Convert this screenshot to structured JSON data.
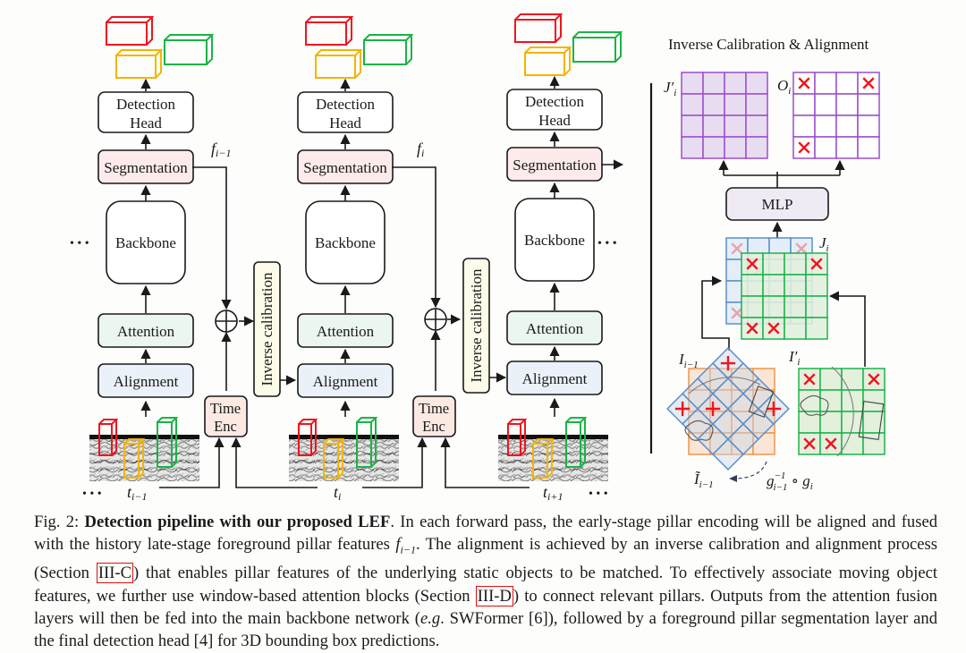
{
  "figure": {
    "pipeline": {
      "stages": [
        {
          "id": "prev",
          "detection_head": [
            "Detection",
            "Head"
          ],
          "segmentation": "Segmentation",
          "backbone": "Backbone",
          "attention": "Attention",
          "alignment": "Alignment",
          "feature_label": "f",
          "feature_sub": "i−1",
          "time_label": "t",
          "time_sub": "i−1"
        },
        {
          "id": "curr",
          "detection_head": [
            "Detection",
            "Head"
          ],
          "segmentation": "Segmentation",
          "backbone": "Backbone",
          "attention": "Attention",
          "alignment": "Alignment",
          "feature_label": "f",
          "feature_sub": "i",
          "time_label": "t",
          "time_sub": "i"
        },
        {
          "id": "next",
          "detection_head": [
            "Detection",
            "Head"
          ],
          "segmentation": "Segmentation",
          "backbone": "Backbone",
          "attention": "Attention",
          "alignment": "Alignment",
          "time_label": "t",
          "time_sub": "i+1"
        }
      ],
      "inverse_calibration": "Inverse calibration",
      "time_enc": [
        "Time",
        "Enc"
      ],
      "ellipsis": "• • •",
      "fusion_symbol": "⊕"
    },
    "inset": {
      "title": "Inverse Calibration & Alignment",
      "mlp": "MLP",
      "labels": {
        "J_prime": "J′",
        "J_prime_sub": "i",
        "O": "O",
        "O_sub": "i",
        "J": "J",
        "J_sub": "i",
        "I_prev": "I",
        "I_prev_sub": "i−1",
        "I_prime": "I′",
        "I_prime_sub": "i",
        "I_tilde": "Ĩ",
        "I_tilde_sub": "i−1",
        "transform": "g",
        "transform_sup": "−1",
        "transform_sub1": "i−1",
        "transform_tail": " ∘ g",
        "transform_sub2": "i"
      }
    },
    "colors": {
      "red_box": "#f0141e",
      "yellow_box": "#f5b400",
      "green_box": "#19b446",
      "segmentation_fill": "#fcebea",
      "attention_fill": "#eaf6ee",
      "alignment_fill": "#eaf1f8",
      "inverse_fill": "#fdfbe9",
      "timeenc_fill": "#fbe9e2",
      "mlp_fill": "#f0eaf4",
      "purple_grid": "#9a4fcc",
      "purple_fill": "#e8dcf0",
      "blue_grid": "#5a8fca",
      "blue_fill": "#e5eef8",
      "green_grid": "#1cb44c",
      "green_fill": "#e2f0dc",
      "orange_grid": "#f0954a",
      "orange_fill": "#fbe6d6"
    }
  },
  "caption": {
    "fig_label": "Fig. 2: ",
    "bold_title": "Detection pipeline with our proposed LEF",
    "text1": ". In each forward pass, the early-stage pillar encoding will be aligned and fused with the history late-stage foreground pillar features ",
    "f_sym": "f",
    "f_sub": "i−1",
    "text2": ". The alignment is achieved by an inverse calibration and alignment process (Section ",
    "ref1": "III-C",
    "text3": ") that enables pillar features of the underlying static objects to be matched. To effectively associate moving object features, we further use window-based attention blocks (Section ",
    "ref2": "III-D",
    "text4": ") to connect relevant pillars. Outputs from the attention fusion layers will then be fed into the main backbone network (",
    "eg": "e.g",
    "text5": ". SWFormer [6]), followed by a foreground pillar segmentation layer and the final detection head [4] for 3D bounding box predictions."
  }
}
